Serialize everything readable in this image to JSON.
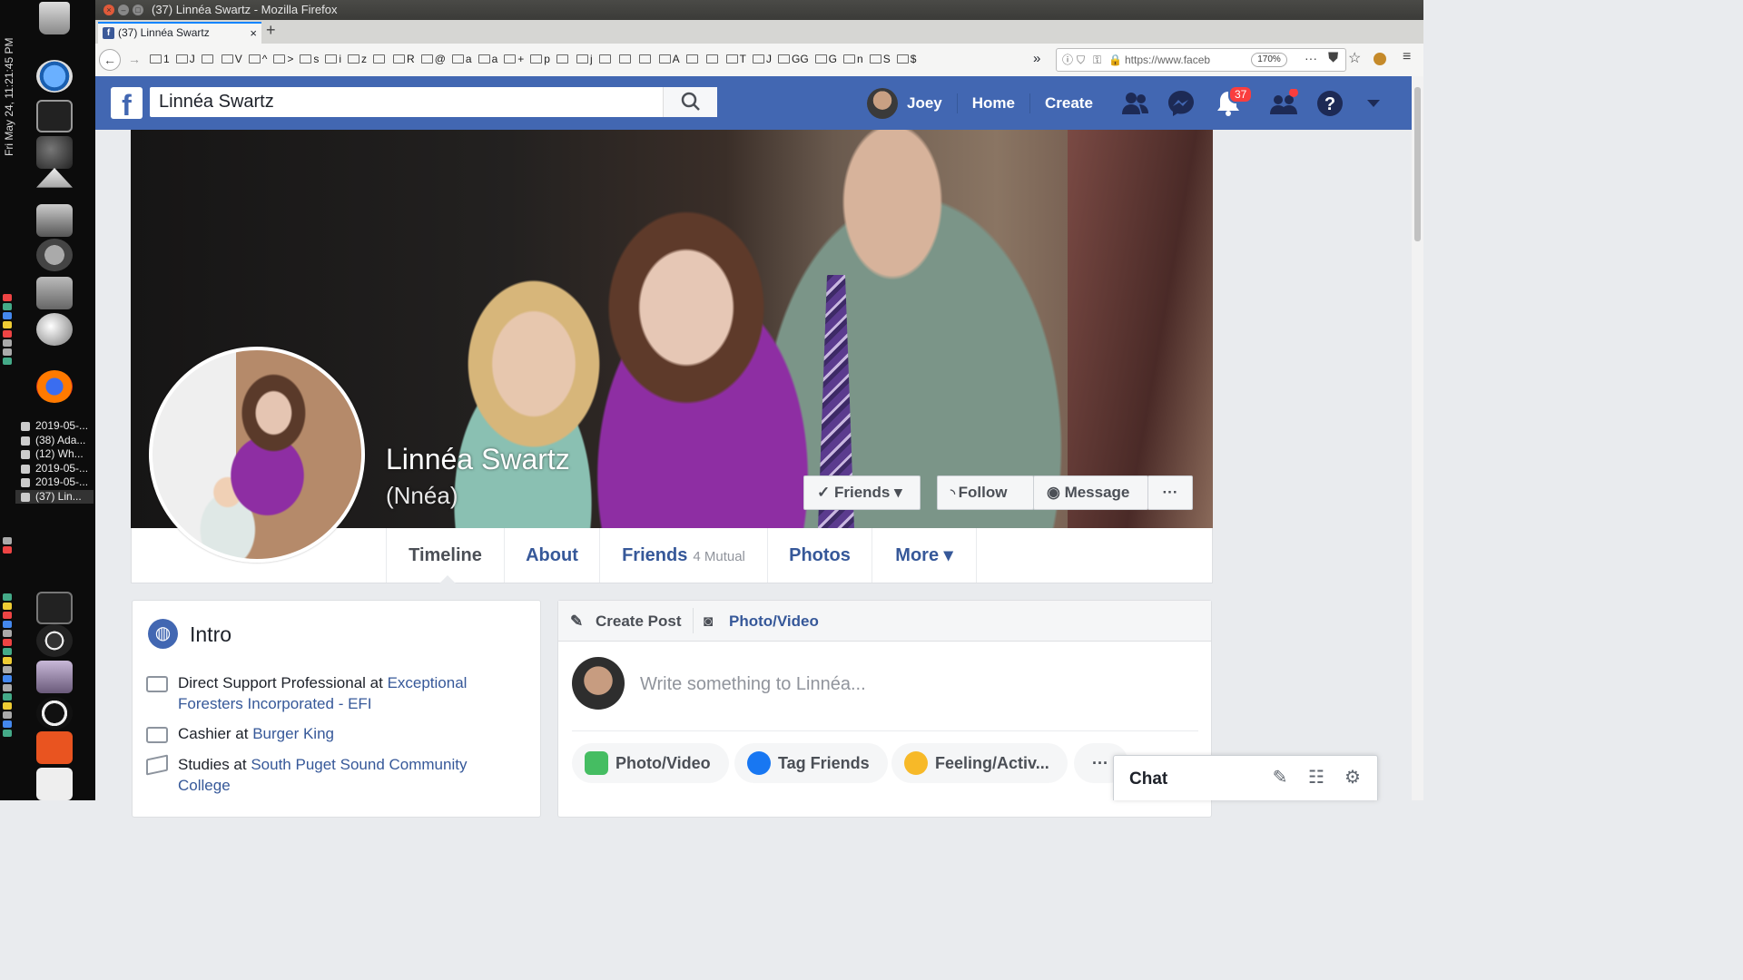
{
  "desktop": {
    "clock": "Fri May 24, 11:21:45 PM",
    "taskbar_windows": [
      "2019-05-...",
      "(38) Ada...",
      "(12) Wh...",
      "2019-05-...",
      "2019-05-...",
      "(37) Lin..."
    ]
  },
  "browser": {
    "window_title": "(37) Linnéa Swartz - Mozilla Firefox",
    "tab_title": "(37) Linnéa Swartz",
    "new_tab": "+",
    "bookmarks": [
      "1",
      "J",
      "",
      "V",
      "^",
      ">",
      "s",
      "i",
      "z",
      "",
      "R",
      "@",
      "a",
      "a",
      "+",
      "p",
      "",
      "j",
      "",
      "",
      "",
      "A",
      "",
      "",
      "T",
      "J",
      "GG",
      "G",
      "n",
      "S",
      "$"
    ],
    "overflow": "»",
    "url": "https://www.faceb",
    "zoom": "170%",
    "menu_dots": "···"
  },
  "facebook": {
    "logo": "f",
    "search_value": "Linnéa Swartz",
    "nav": {
      "user": "Joey",
      "home": "Home",
      "create": "Create"
    },
    "notifications_count": "37",
    "profile": {
      "name": "Linnéa Swartz",
      "alt_name": "(Nnéa)",
      "buttons": {
        "friends": "Friends ▾",
        "follow": "Follow",
        "message": "Message",
        "more": "···"
      }
    },
    "tabs": {
      "timeline": "Timeline",
      "about": "About",
      "friends": "Friends",
      "friends_count": "4 Mutual",
      "photos": "Photos",
      "more": "More ▾"
    },
    "intro": {
      "title": "Intro",
      "items": [
        {
          "text": "Direct Support Professional at ",
          "link": "Exceptional Foresters Incorporated - EFI"
        },
        {
          "text": "Cashier at ",
          "link": "Burger King"
        },
        {
          "text": "Studies at ",
          "link": "South Puget Sound Community College"
        }
      ]
    },
    "composer": {
      "create_post": "Create Post",
      "photo_video_tab": "Photo/Video",
      "placeholder": "Write something to Linnéa...",
      "actions": [
        "Photo/Video",
        "Tag Friends",
        "Feeling/Activ...",
        "···"
      ]
    },
    "chat": {
      "label": "Chat"
    }
  }
}
